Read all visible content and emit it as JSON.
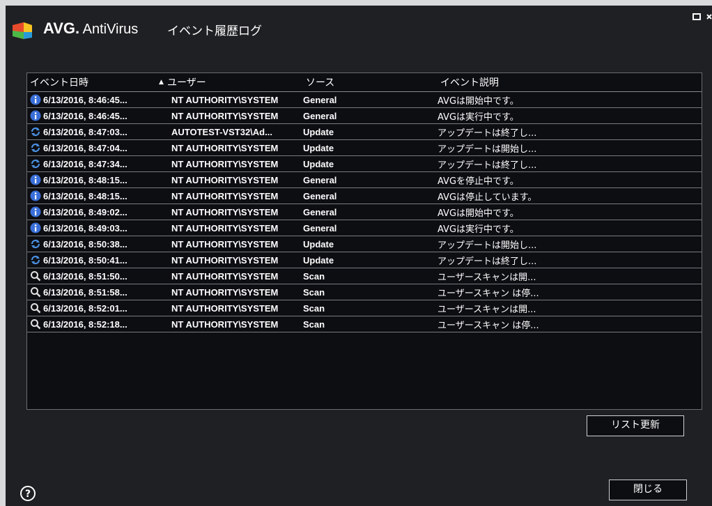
{
  "app": {
    "brand": "AVG.",
    "product": "AntiVirus",
    "window_title": "イベント履歴ログ"
  },
  "window_controls": {
    "restore_icon": "restore-icon",
    "close_icon": "close-icon"
  },
  "table": {
    "headers": {
      "time": "イベント日時",
      "sort_indicator": "▲",
      "user": "ユーザー",
      "source": "ソース",
      "description": "イベント説明"
    },
    "rows": [
      {
        "icon": "info-icon",
        "time": "6/13/2016, 8:46:45...",
        "user": "NT AUTHORITY\\SYSTEM",
        "source": "General",
        "description": "AVGは開始中です。"
      },
      {
        "icon": "info-icon",
        "time": "6/13/2016, 8:46:45...",
        "user": "NT AUTHORITY\\SYSTEM",
        "source": "General",
        "description": "AVGは実行中です。"
      },
      {
        "icon": "update-icon",
        "time": "6/13/2016, 8:47:03...",
        "user": "AUTOTEST-VST32\\Ad...",
        "source": "Update",
        "description": "アップデートは終了し..."
      },
      {
        "icon": "update-icon",
        "time": "6/13/2016, 8:47:04...",
        "user": "NT AUTHORITY\\SYSTEM",
        "source": "Update",
        "description": "アップデートは開始し..."
      },
      {
        "icon": "update-icon",
        "time": "6/13/2016, 8:47:34...",
        "user": "NT AUTHORITY\\SYSTEM",
        "source": "Update",
        "description": "アップデートは終了し..."
      },
      {
        "icon": "info-icon",
        "time": "6/13/2016, 8:48:15...",
        "user": "NT AUTHORITY\\SYSTEM",
        "source": "General",
        "description": "AVGを停止中です。"
      },
      {
        "icon": "info-icon",
        "time": "6/13/2016, 8:48:15...",
        "user": "NT AUTHORITY\\SYSTEM",
        "source": "General",
        "description": "AVGは停止しています。"
      },
      {
        "icon": "info-icon",
        "time": "6/13/2016, 8:49:02...",
        "user": "NT AUTHORITY\\SYSTEM",
        "source": "General",
        "description": "AVGは開始中です。"
      },
      {
        "icon": "info-icon",
        "time": "6/13/2016, 8:49:03...",
        "user": "NT AUTHORITY\\SYSTEM",
        "source": "General",
        "description": "AVGは実行中です。"
      },
      {
        "icon": "update-icon",
        "time": "6/13/2016, 8:50:38...",
        "user": "NT AUTHORITY\\SYSTEM",
        "source": "Update",
        "description": "アップデートは開始し..."
      },
      {
        "icon": "update-icon",
        "time": "6/13/2016, 8:50:41...",
        "user": "NT AUTHORITY\\SYSTEM",
        "source": "Update",
        "description": "アップデートは終了し..."
      },
      {
        "icon": "scan-icon",
        "time": "6/13/2016, 8:51:50...",
        "user": "NT AUTHORITY\\SYSTEM",
        "source": "Scan",
        "description": "ユーザースキャンは開..."
      },
      {
        "icon": "scan-icon",
        "time": "6/13/2016, 8:51:58...",
        "user": "NT AUTHORITY\\SYSTEM",
        "source": "Scan",
        "description": "ユーザースキャン は停..."
      },
      {
        "icon": "scan-icon",
        "time": "6/13/2016, 8:52:01...",
        "user": "NT AUTHORITY\\SYSTEM",
        "source": "Scan",
        "description": "ユーザースキャンは開..."
      },
      {
        "icon": "scan-icon",
        "time": "6/13/2016, 8:52:18...",
        "user": "NT AUTHORITY\\SYSTEM",
        "source": "Scan",
        "description": "ユーザースキャン は停..."
      }
    ]
  },
  "buttons": {
    "refresh": "リスト更新",
    "close": "閉じる"
  },
  "help": {
    "icon": "help-icon",
    "glyph": "?"
  },
  "colors": {
    "background": "#1f2023",
    "panel": "#0d0e12",
    "info_blue": "#3a6fd8",
    "text": "#ffffff"
  }
}
